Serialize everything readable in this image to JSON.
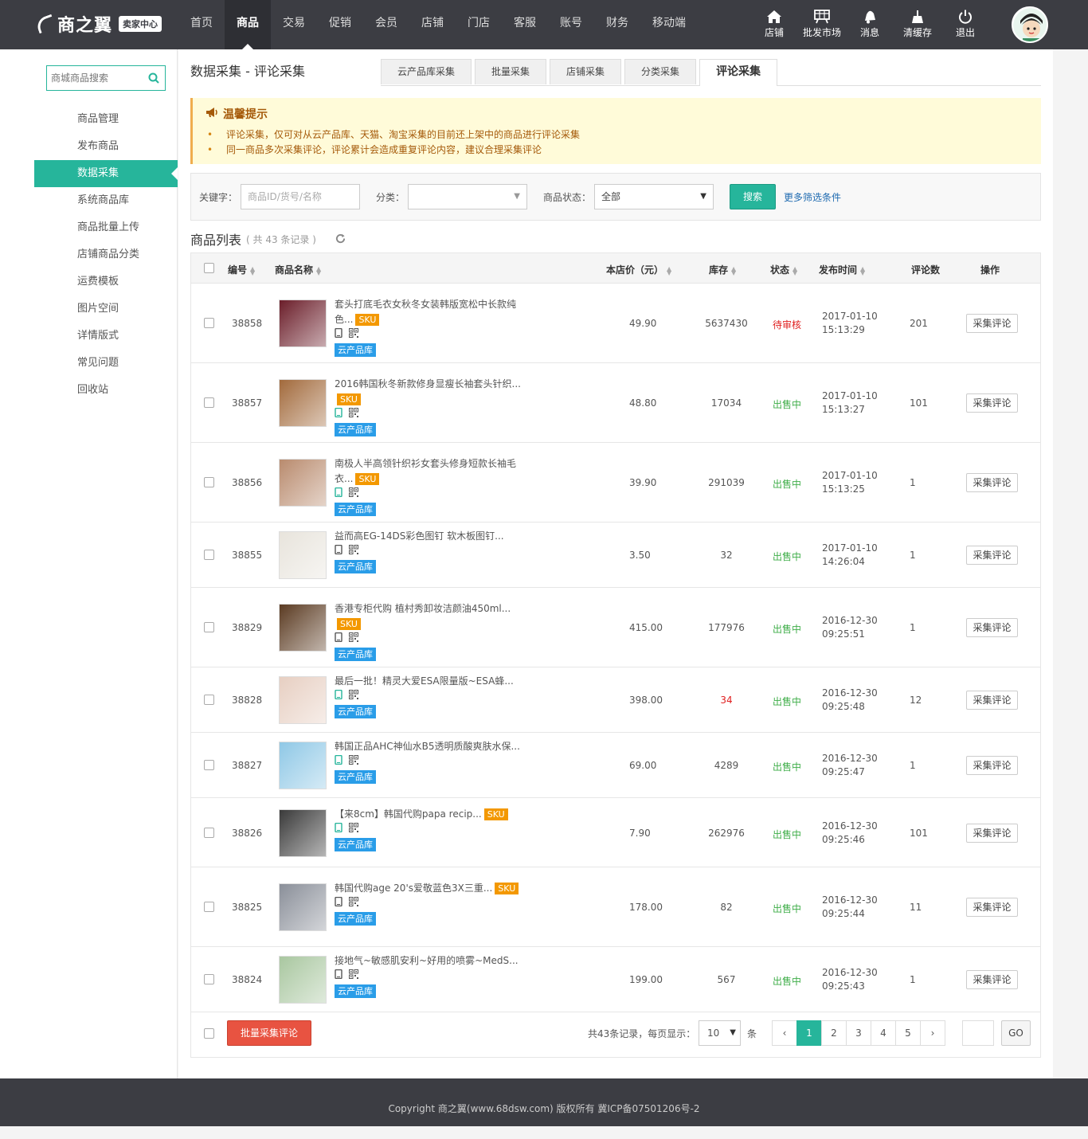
{
  "logo": {
    "name": "商之翼",
    "badge": "卖家中心"
  },
  "nav": [
    "首页",
    "商品",
    "交易",
    "促销",
    "会员",
    "店铺",
    "门店",
    "客服",
    "账号",
    "财务",
    "移动端"
  ],
  "nav_active": 1,
  "tools": [
    {
      "label": "店铺",
      "icon": "home-icon"
    },
    {
      "label": "批发市场",
      "icon": "market-icon"
    },
    {
      "label": "消息",
      "icon": "bell-icon"
    },
    {
      "label": "清缓存",
      "icon": "broom-icon"
    },
    {
      "label": "退出",
      "icon": "power-icon"
    }
  ],
  "sidebar": {
    "search_placeholder": "商城商品搜索",
    "items": [
      "商品管理",
      "发布商品",
      "数据采集",
      "系统商品库",
      "商品批量上传",
      "店铺商品分类",
      "运费模板",
      "图片空间",
      "详情版式",
      "常见问题",
      "回收站"
    ],
    "active": 2
  },
  "page": {
    "title": "数据采集 - 评论采集",
    "tabs": [
      "云产品库采集",
      "批量采集",
      "店铺采集",
      "分类采集",
      "评论采集"
    ],
    "active_tab": 4
  },
  "notice": {
    "title": "温馨提示",
    "items": [
      "评论采集，仅可对从云产品库、天猫、淘宝采集的目前还上架中的商品进行评论采集",
      "同一商品多次采集评论，评论累计会造成重复评论内容，建议合理采集评论"
    ]
  },
  "filter": {
    "keyword_label": "关键字：",
    "keyword_placeholder": "商品ID/货号/名称",
    "category_label": "分类：",
    "category_value": "",
    "status_label": "商品状态：",
    "status_value": "全部",
    "search_button": "搜索",
    "more_link": "更多筛选条件"
  },
  "list": {
    "title": "商品列表",
    "count_text": "( 共 43 条记录 )",
    "headers": {
      "id": "编号",
      "name": "商品名称",
      "price": "本店价（元）",
      "stock": "库存",
      "status": "状态",
      "time": "发布时间",
      "comments": "评论数",
      "op": "操作"
    },
    "op_label": "采集评论",
    "sku_label": "SKU",
    "cloud_label": "云产品库",
    "rows": [
      {
        "id": "38858",
        "name": "套头打底毛衣女秋冬女装韩版宽松中长款纯色...",
        "sku": true,
        "mobile": "gray",
        "price": "49.90",
        "stock": "5637430",
        "stock_red": false,
        "status": "待审核",
        "status_type": "pending",
        "date": "2017-01-10",
        "time": "15:13:29",
        "comments": "201",
        "thumb": "#6b1e2a"
      },
      {
        "id": "38857",
        "name": "2016韩国秋冬新款修身显瘦长袖套头针织...",
        "sku": true,
        "mobile": "green",
        "price": "48.80",
        "stock": "17034",
        "stock_red": false,
        "status": "出售中",
        "status_type": "sale",
        "date": "2017-01-10",
        "time": "15:13:27",
        "comments": "101",
        "thumb": "#a26a3c"
      },
      {
        "id": "38856",
        "name": "南极人半高领针织衫女套头修身短款长袖毛衣...",
        "sku": true,
        "mobile": "green",
        "price": "39.90",
        "stock": "291039",
        "stock_red": false,
        "status": "出售中",
        "status_type": "sale",
        "date": "2017-01-10",
        "time": "15:13:25",
        "comments": "1",
        "thumb": "#b98b6e"
      },
      {
        "id": "38855",
        "name": "益而高EG-14DS彩色图钉 软木板图钉...",
        "sku": false,
        "mobile": "gray",
        "price": "3.50",
        "stock": "32",
        "stock_red": false,
        "status": "出售中",
        "status_type": "sale",
        "date": "2017-01-10",
        "time": "14:26:04",
        "comments": "1",
        "thumb": "#e8e4dc"
      },
      {
        "id": "38829",
        "name": "香港专柜代购 植村秀卸妆洁颜油450ml...",
        "sku": true,
        "mobile": "gray",
        "price": "415.00",
        "stock": "177976",
        "stock_red": false,
        "status": "出售中",
        "status_type": "sale",
        "date": "2016-12-30",
        "time": "09:25:51",
        "comments": "1",
        "thumb": "#5b3b22"
      },
      {
        "id": "38828",
        "name": "最后一批！精灵大爱ESA限量版~ESA蜂...",
        "sku": false,
        "mobile": "green",
        "price": "398.00",
        "stock": "34",
        "stock_red": true,
        "status": "出售中",
        "status_type": "sale",
        "date": "2016-12-30",
        "time": "09:25:48",
        "comments": "12",
        "thumb": "#e7cfc2"
      },
      {
        "id": "38827",
        "name": "韩国正品AHC神仙水B5透明质酸爽肤水保...",
        "sku": false,
        "mobile": "green",
        "price": "69.00",
        "stock": "4289",
        "stock_red": false,
        "status": "出售中",
        "status_type": "sale",
        "date": "2016-12-30",
        "time": "09:25:47",
        "comments": "1",
        "thumb": "#8fc8e6"
      },
      {
        "id": "38826",
        "name": "【来8cm】韩国代购papa recip...",
        "sku": true,
        "mobile": "green",
        "price": "7.90",
        "stock": "262976",
        "stock_red": false,
        "status": "出售中",
        "status_type": "sale",
        "date": "2016-12-30",
        "time": "09:25:46",
        "comments": "101",
        "thumb": "#3a3a3a"
      },
      {
        "id": "38825",
        "name": "韩国代购age 20's爱敬蓝色3X三重...",
        "sku": true,
        "mobile": "gray",
        "price": "178.00",
        "stock": "82",
        "stock_red": false,
        "status": "出售中",
        "status_type": "sale",
        "date": "2016-12-30",
        "time": "09:25:44",
        "comments": "11",
        "thumb": "#8a8f99"
      },
      {
        "id": "38824",
        "name": "接地气~敏感肌安利~好用的喷雾~MedS...",
        "sku": false,
        "mobile": "gray",
        "price": "199.00",
        "stock": "567",
        "stock_red": false,
        "status": "出售中",
        "status_type": "sale",
        "date": "2016-12-30",
        "time": "09:25:43",
        "comments": "1",
        "thumb": "#a9c7a0"
      }
    ]
  },
  "footer": {
    "batch_button": "批量采集评论",
    "records_text": "共43条记录，每页显示：",
    "per_page": "10",
    "unit": "条",
    "pages": [
      "‹",
      "1",
      "2",
      "3",
      "4",
      "5",
      "›"
    ],
    "active_page": "1",
    "go_label": "GO"
  },
  "copyright": "Copyright 商之翼(www.68dsw.com) 版权所有    冀ICP备07501206号-2",
  "colors": {
    "brand": "#26b59b",
    "topbar": "#3c3d43",
    "danger": "#e85341",
    "sku": "#f39800",
    "cloud": "#2a9de8"
  }
}
